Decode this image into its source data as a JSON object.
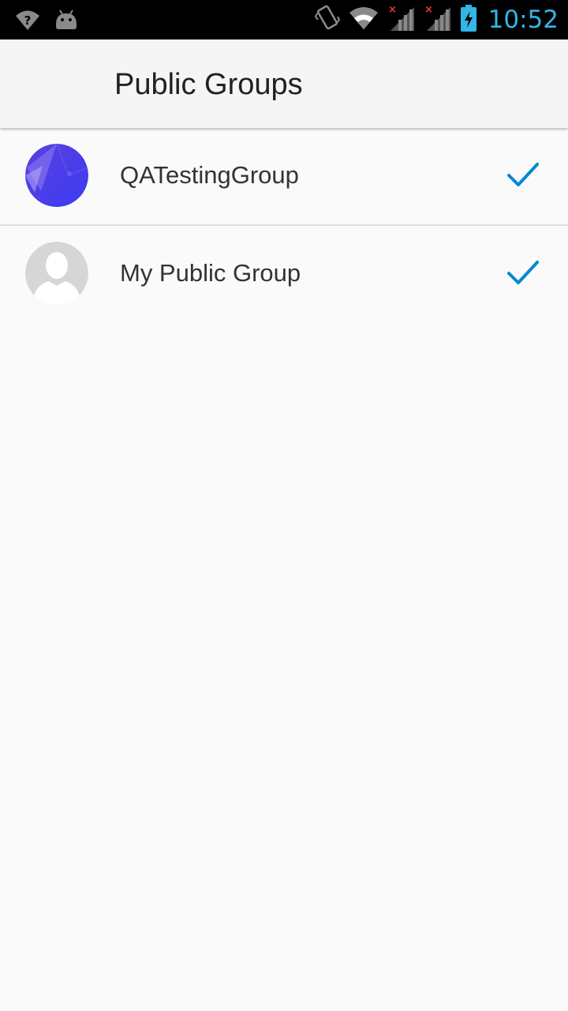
{
  "status_bar": {
    "time": "10:52",
    "time_color": "#33b5e5",
    "left_icons": [
      "wifi-unknown-icon",
      "android-debug-icon"
    ],
    "right_icons": [
      "vibrate-icon",
      "wifi-icon",
      "signal-no-service-icon",
      "signal-no-service-icon",
      "battery-charging-icon"
    ]
  },
  "app_bar": {
    "title": "Public Groups"
  },
  "groups": [
    {
      "name": "QATestingGroup",
      "avatar": "group-photo-avatar",
      "checked": true
    },
    {
      "name": "My Public Group",
      "avatar": "default-person-avatar",
      "checked": true
    }
  ],
  "colors": {
    "accent": "#0288d1",
    "background": "#fafafa",
    "app_bar": "#f5f5f5"
  }
}
